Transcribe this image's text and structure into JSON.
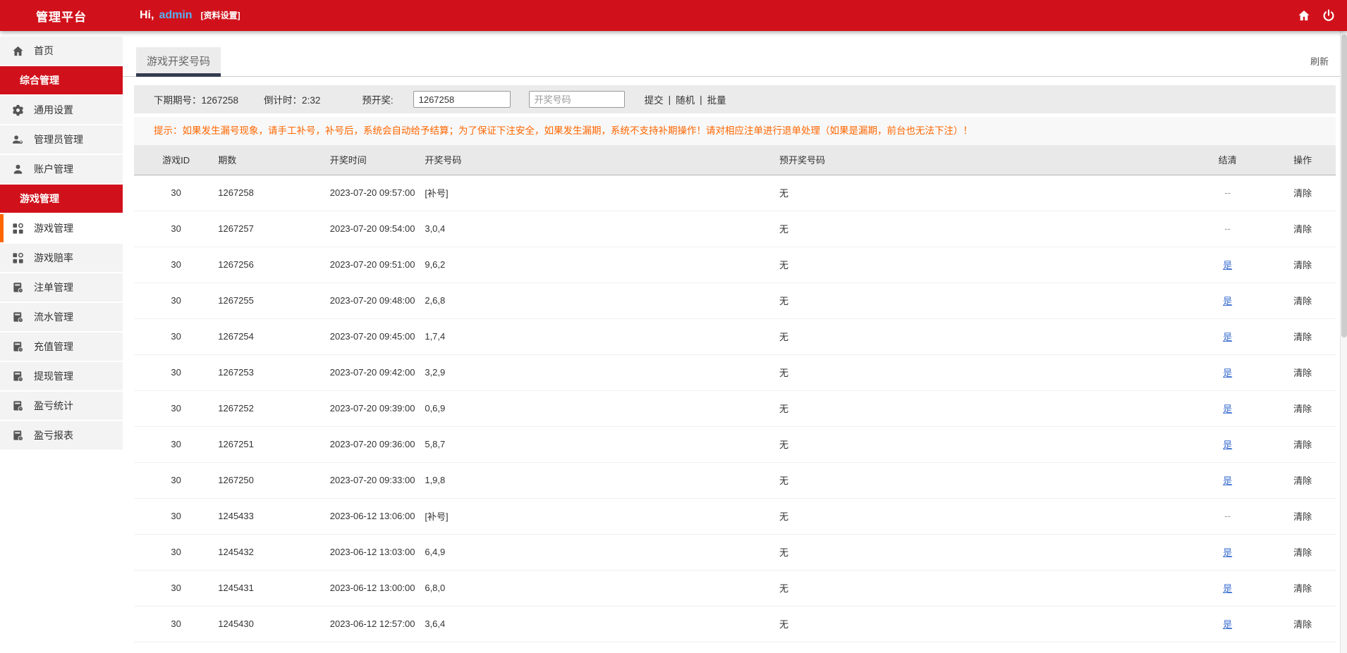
{
  "colors": {
    "topbar_red": "#d0111b",
    "active_accent_orange": "#ff6600",
    "notice_orange": "#ff6600",
    "link_blue": "#3c6fd1",
    "tab_underline_navy": "#333b4f",
    "username_blue": "#55b1f0"
  },
  "topbar": {
    "brand": "管理平台",
    "greeting_prefix": "Hi,",
    "username": "admin",
    "profile_link": "[资料设置]",
    "icons": [
      "home-icon",
      "power-icon"
    ]
  },
  "sidebar": {
    "items": [
      {
        "id": "home",
        "label": "首页",
        "type": "item",
        "icon": "home-icon"
      },
      {
        "id": "general-section",
        "label": "综合管理",
        "type": "section"
      },
      {
        "id": "general-settings",
        "label": "通用设置",
        "type": "item",
        "icon": "gear-icon"
      },
      {
        "id": "admin-management",
        "label": "管理员管理",
        "type": "item",
        "icon": "users-icon"
      },
      {
        "id": "account-management",
        "label": "账户管理",
        "type": "item",
        "icon": "user-icon"
      },
      {
        "id": "game-section",
        "label": "游戏管理",
        "type": "section"
      },
      {
        "id": "game-management",
        "label": "游戏管理",
        "type": "item",
        "icon": "grid-icon",
        "active": true
      },
      {
        "id": "game-odds",
        "label": "游戏赔率",
        "type": "item",
        "icon": "grid-icon"
      },
      {
        "id": "bet-orders",
        "label": "注单管理",
        "type": "item",
        "icon": "doc-icon"
      },
      {
        "id": "transactions",
        "label": "流水管理",
        "type": "item",
        "icon": "doc-icon"
      },
      {
        "id": "recharge",
        "label": "充值管理",
        "type": "item",
        "icon": "doc-icon"
      },
      {
        "id": "withdrawal",
        "label": "提现管理",
        "type": "item",
        "icon": "doc-icon"
      },
      {
        "id": "profit-stats",
        "label": "盈亏统计",
        "type": "item",
        "icon": "doc-icon"
      },
      {
        "id": "profit-report",
        "label": "盈亏报表",
        "type": "item",
        "icon": "doc-icon"
      }
    ]
  },
  "content": {
    "tab_label": "游戏开奖号码",
    "refresh_label": "刷新",
    "toolbar": {
      "next_issue": "下期期号：1267258",
      "countdown": "倒计时：2:32",
      "predraw_label": "预开奖:",
      "predraw_value": "1267258",
      "draw_placeholder": "开奖号码",
      "actions": [
        "提交",
        "随机",
        "批量"
      ],
      "separator": "|"
    },
    "notice": "提示：如果发生漏号现象，请手工补号，补号后，系统会自动给予结算；为了保证下注安全，如果发生漏期，系统不支持补期操作！请对相应注单进行退单处理（如果是漏期，前台也无法下注）！",
    "table": {
      "headers": [
        "游戏ID",
        "期数",
        "开奖时间",
        "开奖号码",
        "预开奖号码",
        "结清",
        "操作"
      ],
      "rows": [
        {
          "game_id": "30",
          "issue": "1267258",
          "time": "2023-07-20 09:57:00",
          "numbers": "[补号]",
          "predraw": "无",
          "settled": "--",
          "action": "清除"
        },
        {
          "game_id": "30",
          "issue": "1267257",
          "time": "2023-07-20 09:54:00",
          "numbers": "3,0,4",
          "predraw": "无",
          "settled": "--",
          "action": "清除"
        },
        {
          "game_id": "30",
          "issue": "1267256",
          "time": "2023-07-20 09:51:00",
          "numbers": "9,6,2",
          "predraw": "无",
          "settled": "是",
          "action": "清除"
        },
        {
          "game_id": "30",
          "issue": "1267255",
          "time": "2023-07-20 09:48:00",
          "numbers": "2,6,8",
          "predraw": "无",
          "settled": "是",
          "action": "清除"
        },
        {
          "game_id": "30",
          "issue": "1267254",
          "time": "2023-07-20 09:45:00",
          "numbers": "1,7,4",
          "predraw": "无",
          "settled": "是",
          "action": "清除"
        },
        {
          "game_id": "30",
          "issue": "1267253",
          "time": "2023-07-20 09:42:00",
          "numbers": "3,2,9",
          "predraw": "无",
          "settled": "是",
          "action": "清除"
        },
        {
          "game_id": "30",
          "issue": "1267252",
          "time": "2023-07-20 09:39:00",
          "numbers": "0,6,9",
          "predraw": "无",
          "settled": "是",
          "action": "清除"
        },
        {
          "game_id": "30",
          "issue": "1267251",
          "time": "2023-07-20 09:36:00",
          "numbers": "5,8,7",
          "predraw": "无",
          "settled": "是",
          "action": "清除"
        },
        {
          "game_id": "30",
          "issue": "1267250",
          "time": "2023-07-20 09:33:00",
          "numbers": "1,9,8",
          "predraw": "无",
          "settled": "是",
          "action": "清除"
        },
        {
          "game_id": "30",
          "issue": "1245433",
          "time": "2023-06-12 13:06:00",
          "numbers": "[补号]",
          "predraw": "无",
          "settled": "--",
          "action": "清除"
        },
        {
          "game_id": "30",
          "issue": "1245432",
          "time": "2023-06-12 13:03:00",
          "numbers": "6,4,9",
          "predraw": "无",
          "settled": "是",
          "action": "清除"
        },
        {
          "game_id": "30",
          "issue": "1245431",
          "time": "2023-06-12 13:00:00",
          "numbers": "6,8,0",
          "predraw": "无",
          "settled": "是",
          "action": "清除"
        },
        {
          "game_id": "30",
          "issue": "1245430",
          "time": "2023-06-12 12:57:00",
          "numbers": "3,6,4",
          "predraw": "无",
          "settled": "是",
          "action": "清除"
        }
      ]
    }
  }
}
